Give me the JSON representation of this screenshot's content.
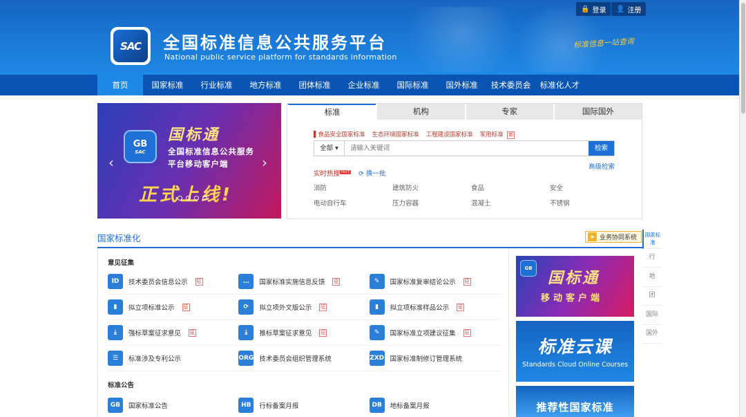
{
  "header": {
    "login": "登录",
    "register": "注册",
    "logo": "SAC",
    "title": "全国标准信息公共服务平台",
    "subtitle": "National public service platform  for standards information",
    "slogan": "标准信息一站查询"
  },
  "nav": [
    "首页",
    "国家标准",
    "行业标准",
    "地方标准",
    "团体标准",
    "企业标准",
    "国际标准",
    "国外标准",
    "技术委员会",
    "标准化人才"
  ],
  "banner": {
    "logo_top": "GB",
    "logo_bottom": "SAC",
    "line1": "国标通",
    "line2": "全国标准信息公共服务",
    "line3": "平台移动客户端",
    "line4": "正式上线!"
  },
  "search": {
    "tabs": [
      "标准",
      "机构",
      "专家",
      "国际国外"
    ],
    "tags": [
      "食品安全国家标准",
      "生态环境国家标准",
      "工程建设国家标准",
      "军用标准"
    ],
    "tag_badge": "新",
    "scope": "全部",
    "placeholder": "请输入关键词",
    "button": "检索",
    "advanced": "高级检索",
    "hot_label": "实时热搜",
    "hot_badge": "HOT",
    "refresh": "换一批",
    "hot": [
      "消防",
      "建筑防火",
      "食品",
      "安全",
      "电动自行车",
      "压力容器",
      "混凝土",
      "不锈钢"
    ]
  },
  "section": {
    "title": "国家标准化",
    "collab": "业务协同系统",
    "group1": "意见征集",
    "group2": "标准公告",
    "badge": "征",
    "rows": [
      [
        {
          "icon": "ID",
          "label": "技术委员会信息公示",
          "badge": true
        },
        {
          "icon": "…",
          "label": "国家标准实施信息反馈",
          "badge": true
        },
        {
          "icon": "✎",
          "label": "国家标准复审结论公示",
          "badge": true
        }
      ],
      [
        {
          "icon": "▮",
          "label": "拟立项标准公示",
          "badge": true
        },
        {
          "icon": "⟳",
          "label": "拟立项外文版公示",
          "badge": true
        },
        {
          "icon": "▮",
          "label": "拟立项标准样品公示",
          "badge": true
        }
      ],
      [
        {
          "icon": "⤓",
          "label": "强标草案征求意见",
          "badge": true
        },
        {
          "icon": "⤓",
          "label": "推标草案征求意见",
          "badge": true
        },
        {
          "icon": "✎",
          "label": "国家标准立项建议征集",
          "badge": true
        }
      ],
      [
        {
          "icon": "☰",
          "label": "标准涉及专利公示",
          "badge": false
        },
        {
          "icon": "ORG",
          "label": "技术委员会组织管理系统",
          "badge": false
        },
        {
          "icon": "ZXD",
          "label": "国家标准制修订管理系统",
          "badge": false
        }
      ],
      [
        {
          "icon": "GB",
          "label": "国家标准公告",
          "badge": false
        },
        {
          "icon": "HB",
          "label": "行标备案月报",
          "badge": false
        },
        {
          "icon": "DB",
          "label": "地标备案月报",
          "badge": false
        }
      ]
    ]
  },
  "promos": {
    "p1_logo": "GB",
    "p1_title": "国标通",
    "p1_sub": "移动客户端",
    "p2_title": "标准云课",
    "p2_sub": "Standards Cloud Online Courses",
    "p3_title": "推荐性国家标准"
  },
  "side_tabs": [
    "国家标准",
    "行",
    "地",
    "团",
    "国际",
    "国外"
  ]
}
